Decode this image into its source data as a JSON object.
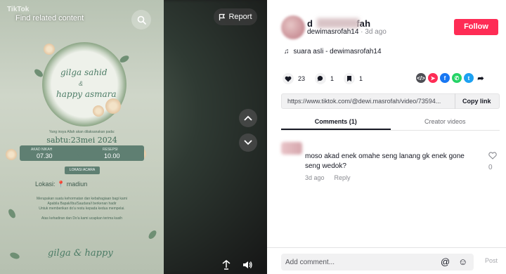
{
  "video": {
    "tiktok_logo": "TikTok",
    "find_related": "Find related content",
    "report_label": "Report",
    "invitation": {
      "name1": "gilga sahid",
      "and": "&",
      "name2": "happy asmara",
      "invite_line": "Yang insya Allah akan dilaksanakan pada:",
      "date": "sabtu:23mei 2024",
      "akad_label": "AKAD NIKAH",
      "akad_time": "07.30",
      "resepsi_label": "RESEPSI",
      "resepsi_time": "10.00",
      "lokasi_button": "LOKASI ACARA",
      "lokasi": "Lokasi:",
      "city": "madiun",
      "closing1": "Merupakan suatu kehormatan dan kebahagiaan bagi kami",
      "closing2": "Apabila Bapak/Ibu/Saudara/i berkenan hadir",
      "closing3": "Untuk memberikan do'a restu kepada kedua mempelai.",
      "thanks": "Atas kehadiran dan Do'a kami ucapkan terima kasih",
      "footer": "gilga & happy"
    }
  },
  "panel": {
    "username_prefix": "d",
    "username_suffix": "fah",
    "handle": "dewimasrofah14",
    "separator": "·",
    "posted": "3d ago",
    "follow_label": "Follow",
    "music": "suara asli - dewimasrofah14",
    "likes": "23",
    "comments_count": "1",
    "saves": "1",
    "link": "https://www.tiktok.com/@dewi.masrofah/video/73594...",
    "copy_link": "Copy link",
    "tabs": [
      "Comments (1)",
      "Creator videos"
    ],
    "comment": {
      "text": "moso akad enek omahe seng lanang gk enek gone seng wedok?",
      "time": "3d ago",
      "reply": "Reply",
      "like_count": "0"
    },
    "add_comment_placeholder": "Add comment...",
    "post_label": "Post"
  },
  "colors": {
    "follow": "#fe2c55",
    "invitation_green": "#5f7f72"
  }
}
